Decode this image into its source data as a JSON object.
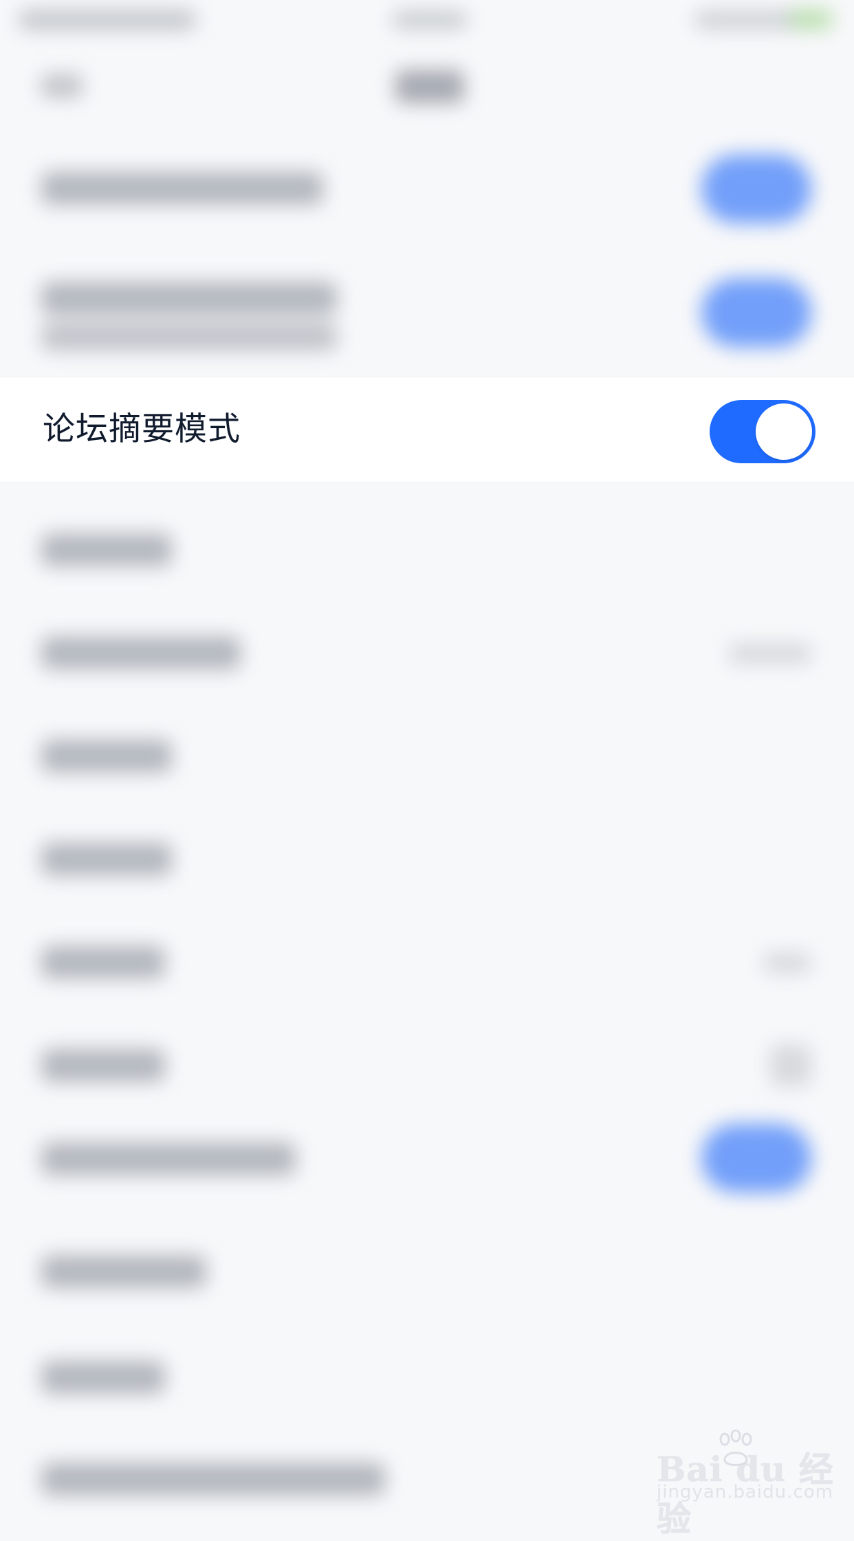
{
  "setting_row": {
    "label": "论坛摘要模式",
    "enabled": true
  },
  "watermark": {
    "brand": "Bai du 经验",
    "domain": "jingyan.baidu.com"
  },
  "colors": {
    "accent": "#1f6bff",
    "label_text": "#111b2e",
    "background": "#f7f8fa"
  }
}
